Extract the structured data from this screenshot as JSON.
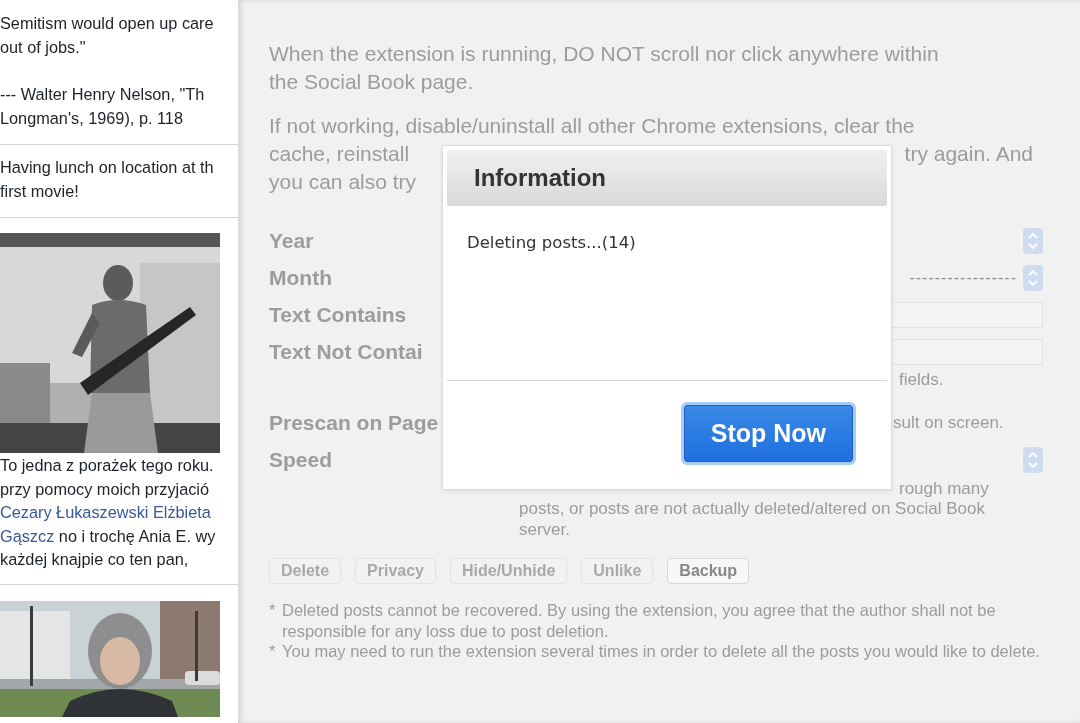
{
  "feed": {
    "posts": [
      {
        "kind": "text",
        "paragraphs": [
          [
            "Semitism would open up care",
            "out of jobs.\""
          ],
          [
            "--- Walter Henry Nelson, \"Th",
            "Longman's, 1969), p. 118"
          ]
        ]
      },
      {
        "kind": "text",
        "paragraphs": [
          [
            "Having lunch on location at th",
            "first movie!"
          ]
        ]
      },
      {
        "lines": [
          "To jedna z porażek tego roku.",
          "przy pomocy moich przyjació",
          "**Cezary Łukaszewski Elżbieta**",
          "**Gąszcz** no i trochę Ania E. wy",
          "każdej knajpie co ten pan,"
        ]
      },
      {
        "kind": "video"
      }
    ]
  },
  "panel": {
    "intro": [
      [
        "When the extension is running, DO NOT scroll nor click anywhere within",
        "the Social Book page."
      ]
    ],
    "covered_paragraph": [
      {
        "left": "If not working, disable/uninstall all other Chrome extensions, clear the"
      },
      {
        "left": "cache, reinstall",
        "right": "try again. And"
      },
      {
        "left": "you can also try"
      }
    ],
    "rows": [
      {
        "label": "Year",
        "kind": "select"
      },
      {
        "label": "Month",
        "kind": "select",
        "value": "-----------------"
      },
      {
        "label": "Text Contains",
        "kind": "text"
      },
      {
        "label": "Text Not Contai",
        "kind": "text",
        "hint": "fields."
      },
      {
        "label": "Prescan on Page",
        "kind": "note",
        "note": "sult on screen."
      },
      {
        "label": "Speed",
        "kind": "select",
        "hint": "rough many",
        "hints": [
          "posts, or posts are not actually deleted/altered on Social Book",
          "server."
        ]
      }
    ],
    "buttons": [
      {
        "label": "Delete",
        "disabled": true
      },
      {
        "label": "Privacy",
        "disabled": true
      },
      {
        "label": "Hide/Unhide",
        "disabled": true
      },
      {
        "label": "Unlike",
        "disabled": true
      },
      {
        "label": "Backup",
        "disabled": false
      }
    ],
    "notes": [
      {
        "mark": "*",
        "text": "Deleted posts cannot be recovered. By using the extension, you agree that the author shall not be responsible for any loss due to post deletion."
      },
      {
        "mark": "*",
        "text": "You may need to run the extension several times in order to delete all the posts you would like to delete."
      }
    ]
  },
  "dialog": {
    "title": "Information",
    "message": "Deleting posts...(14)",
    "button": "Stop Now"
  }
}
